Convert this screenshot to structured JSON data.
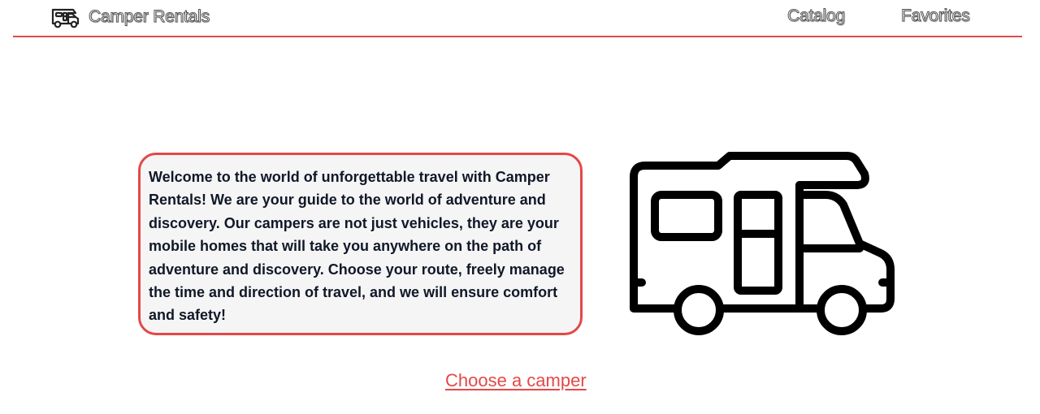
{
  "header": {
    "logo_icon": "camper-van-icon",
    "brand": "Camper Rentals",
    "nav": {
      "catalog": "Catalog",
      "favorites": "Favorites"
    }
  },
  "main": {
    "intro_text": "Welcome to the world of unforgettable travel with Camper Rentals! We are your guide to the world of adventure and discovery. Our campers are not just vehicles, they are your mobile homes that will take you anywhere on the path of adventure and discovery. Choose your route, freely manage the time and direction of travel, and we will ensure comfort and safety!",
    "illustration_icon": "camper-van-icon",
    "cta": "Choose a camper"
  },
  "colors": {
    "accent": "#e44848",
    "text": "#101828",
    "box_background": "#f5f5f5"
  }
}
